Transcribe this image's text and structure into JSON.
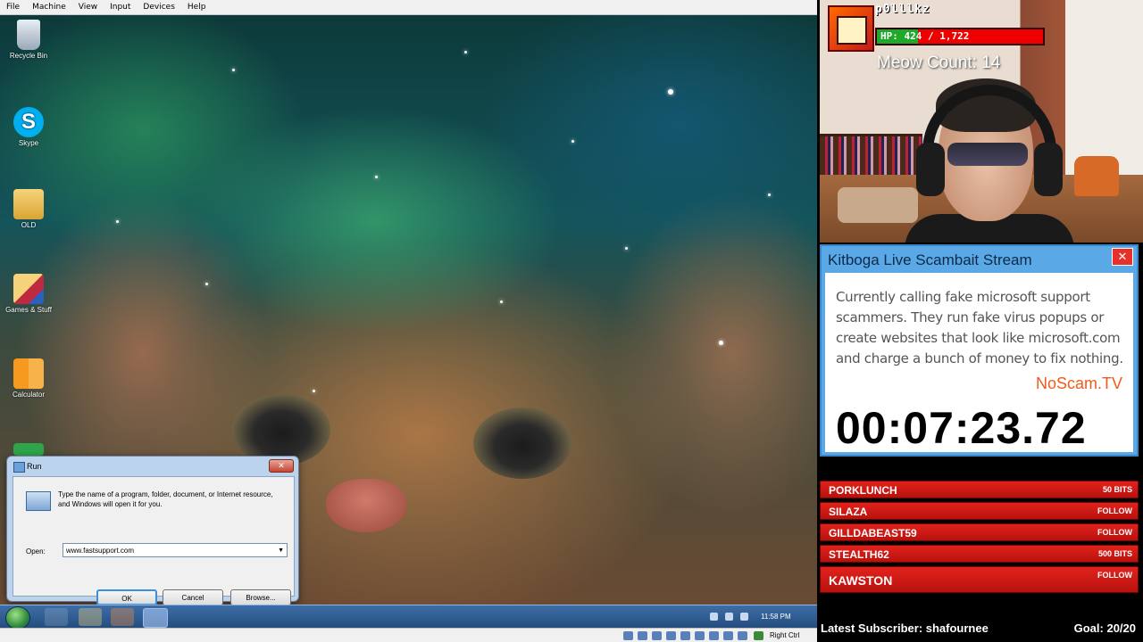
{
  "vm_menu": [
    "File",
    "Machine",
    "View",
    "Input",
    "Devices",
    "Help"
  ],
  "desktop_icons": [
    {
      "label": "Recycle Bin",
      "icon": "recycle-bin-icon"
    },
    {
      "label": "Skype",
      "icon": "skype-icon"
    },
    {
      "label": "OLD",
      "icon": "folder-icon"
    },
    {
      "label": "Games & Stuff",
      "icon": "folder-icon"
    },
    {
      "label": "Calculator",
      "icon": "calculator-icon"
    }
  ],
  "run_dialog": {
    "title": "Run",
    "description": "Type the name of a program, folder, document, or Internet resource, and Windows will open it for you.",
    "open_label": "Open:",
    "input_value": "www.fastsupport.com",
    "ok_label": "OK",
    "cancel_label": "Cancel",
    "browse_label": "Browse..."
  },
  "taskbar": {
    "clock": "11:58 PM"
  },
  "statusbar": {
    "host_key": "Right Ctrl"
  },
  "stream": {
    "username": "p0lllkz",
    "hp_text": "HP: 424 / 1,722",
    "hp_fraction": 0.246,
    "meow_count": "Meow Count: 14",
    "panel_title": "Kitboga Live Scambait Stream",
    "panel_close": "✕",
    "panel_text": "Currently calling fake microsoft support scammers. They run fake virus popups or create websites that look like microsoft.com and charge a bunch of money to fix nothing.",
    "panel_link": "NoScam.TV",
    "timer": "00:07:23.72",
    "events": [
      {
        "name": "PORKLUNCH",
        "tag": "50 BITS"
      },
      {
        "name": "SILAZA",
        "tag": "FOLLOW"
      },
      {
        "name": "GILLDABEAST59",
        "tag": "FOLLOW"
      },
      {
        "name": "STEALTH62",
        "tag": "500 BITS"
      },
      {
        "name": "KAWSTON",
        "tag": "FOLLOW"
      }
    ],
    "latest_subscriber": "Latest Subscriber: shafournee",
    "goal": "Goal: 20/20"
  },
  "colors": {
    "accent_red": "#e2221c",
    "hp_green": "#1fa82a",
    "panel_blue": "#5aa9e6",
    "link_orange": "#f05a1a"
  }
}
